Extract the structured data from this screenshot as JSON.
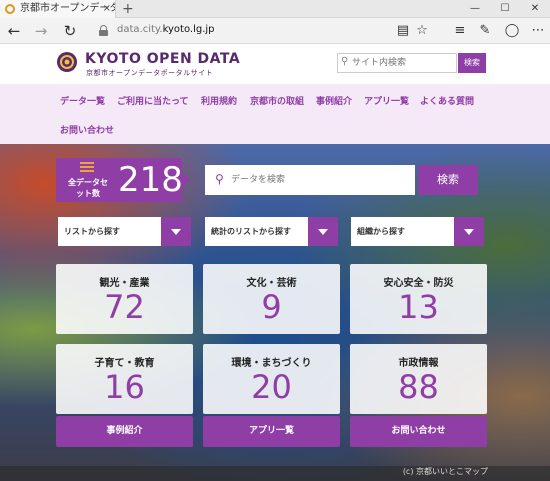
{
  "browser": {
    "tab_title": "京都市オープンデータポータ",
    "tab_close": "×",
    "new_tab": "+",
    "url_prefix": "data.city.",
    "url_domain": "kyoto.lg.jp",
    "icons": [
      "back-icon",
      "forward-icon",
      "refresh-icon",
      "lock-icon",
      "reading-view-icon",
      "star-icon",
      "hub-icon",
      "notes-icon",
      "share-icon",
      "more-icon"
    ],
    "window_controls": [
      "—",
      "☐",
      "✕"
    ]
  },
  "header": {
    "logo_title": "KYOTO OPEN DATA",
    "logo_sub": "京都市オープンデータポータルサイト",
    "search_placeholder": "サイト内検索",
    "search_button": "検索"
  },
  "nav": {
    "items": [
      "データ一覧",
      "ご利用に当たって",
      "利用規約",
      "京都市の取組",
      "事例紹介",
      "アプリ一覧",
      "よくある質問",
      "お問い合わせ"
    ]
  },
  "hero": {
    "count_label": "全データセット数",
    "count_value": "218",
    "search_placeholder": "データを検索",
    "search_button": "検索",
    "selects": [
      "リストから探す",
      "統計のリストから探す",
      "組織から探す"
    ],
    "categories": [
      {
        "name": "観光・産業",
        "count": "72"
      },
      {
        "name": "文化・芸術",
        "count": "9"
      },
      {
        "name": "安心安全・防災",
        "count": "13"
      },
      {
        "name": "子育て・教育",
        "count": "16"
      },
      {
        "name": "環境・まちづくり",
        "count": "20"
      },
      {
        "name": "市政情報",
        "count": "88"
      }
    ],
    "buttons": [
      "事例紹介",
      "アプリ一覧",
      "お問い合わせ"
    ],
    "caption": "(c) 京都いいとこマップ"
  },
  "colors": {
    "accent": "#8f3ea6",
    "nav_bg": "#f5e8f7",
    "logo": "#5a2a6e",
    "count_icon": "#f0a23a"
  }
}
